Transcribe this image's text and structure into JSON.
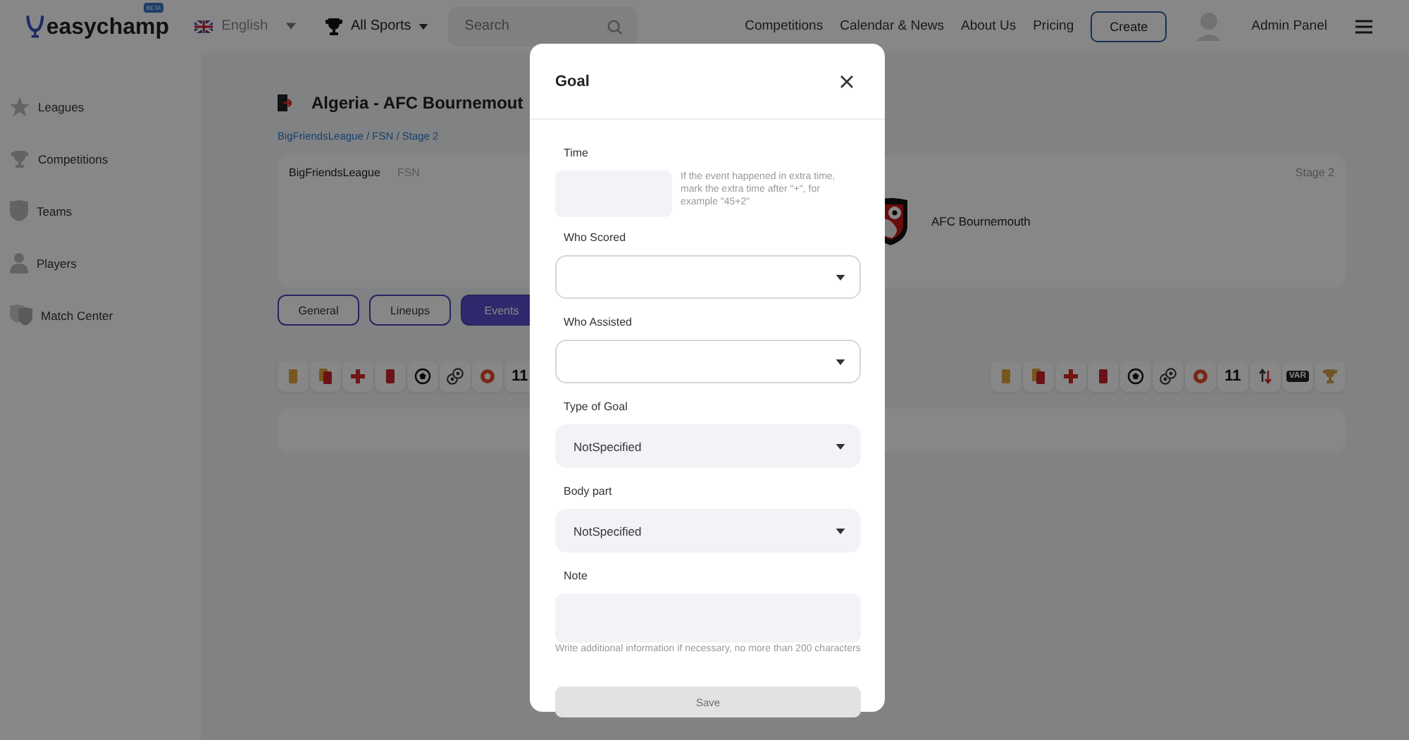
{
  "header": {
    "logo": "easychamp",
    "beta": "BETA",
    "language": "English",
    "sport": "All Sports",
    "search": {
      "placeholder": "Search"
    },
    "nav": [
      "Competitions",
      "Calendar & News",
      "About Us",
      "Pricing"
    ],
    "create": "Create",
    "admin": "Admin Panel"
  },
  "sidebar": {
    "items": [
      {
        "label": "Leagues",
        "kind": "star"
      },
      {
        "label": "Competitions",
        "kind": "trophy"
      },
      {
        "label": "Teams",
        "kind": "shield"
      },
      {
        "label": "Players",
        "kind": "person"
      },
      {
        "label": "Match Center",
        "kind": "shields"
      }
    ]
  },
  "match": {
    "title": "Algeria - AFC Bournemout",
    "breadcrumb": "BigFriendsLeague / FSN / Stage 2",
    "league": "BigFriendsLeague",
    "competition": "FSN",
    "stage": "Stage 2",
    "away_team": "AFC Bournemouth"
  },
  "tabs": [
    {
      "label": "General",
      "selected": false
    },
    {
      "label": "Lineups",
      "selected": false
    },
    {
      "label": "Events",
      "selected": true
    }
  ],
  "home_events": [
    {
      "kind": "yellow-card"
    },
    {
      "kind": "two-cards"
    },
    {
      "kind": "cross"
    },
    {
      "kind": "red-card"
    },
    {
      "kind": "ball"
    },
    {
      "kind": "balls"
    },
    {
      "kind": "red-ball"
    },
    {
      "kind": "text",
      "text": "11"
    }
  ],
  "away_events": [
    {
      "kind": "yellow-card"
    },
    {
      "kind": "two-cards"
    },
    {
      "kind": "cross"
    },
    {
      "kind": "red-card"
    },
    {
      "kind": "ball"
    },
    {
      "kind": "balls"
    },
    {
      "kind": "red-ball"
    },
    {
      "kind": "text",
      "text": "11"
    },
    {
      "kind": "swap"
    },
    {
      "kind": "badge",
      "text": "VAR"
    },
    {
      "kind": "trophy"
    }
  ],
  "modal": {
    "title": "Goal",
    "fields": [
      {
        "kind": "input",
        "label": "Time",
        "hint": "If the event happened in extra time, mark the extra time after \"+\", for example \"45+2\""
      },
      {
        "kind": "select",
        "label": "Who Scored"
      },
      {
        "kind": "select",
        "label": "Who Assisted"
      },
      {
        "kind": "select",
        "label": "Type of Goal",
        "value": "NotSpecified"
      },
      {
        "kind": "select",
        "label": "Body part",
        "value": "NotSpecified"
      },
      {
        "kind": "textarea",
        "label": "Note",
        "hint": "Write additional information if necessary, no more than 200 characters"
      }
    ],
    "save": {
      "label": "Save",
      "disabled": true
    }
  }
}
